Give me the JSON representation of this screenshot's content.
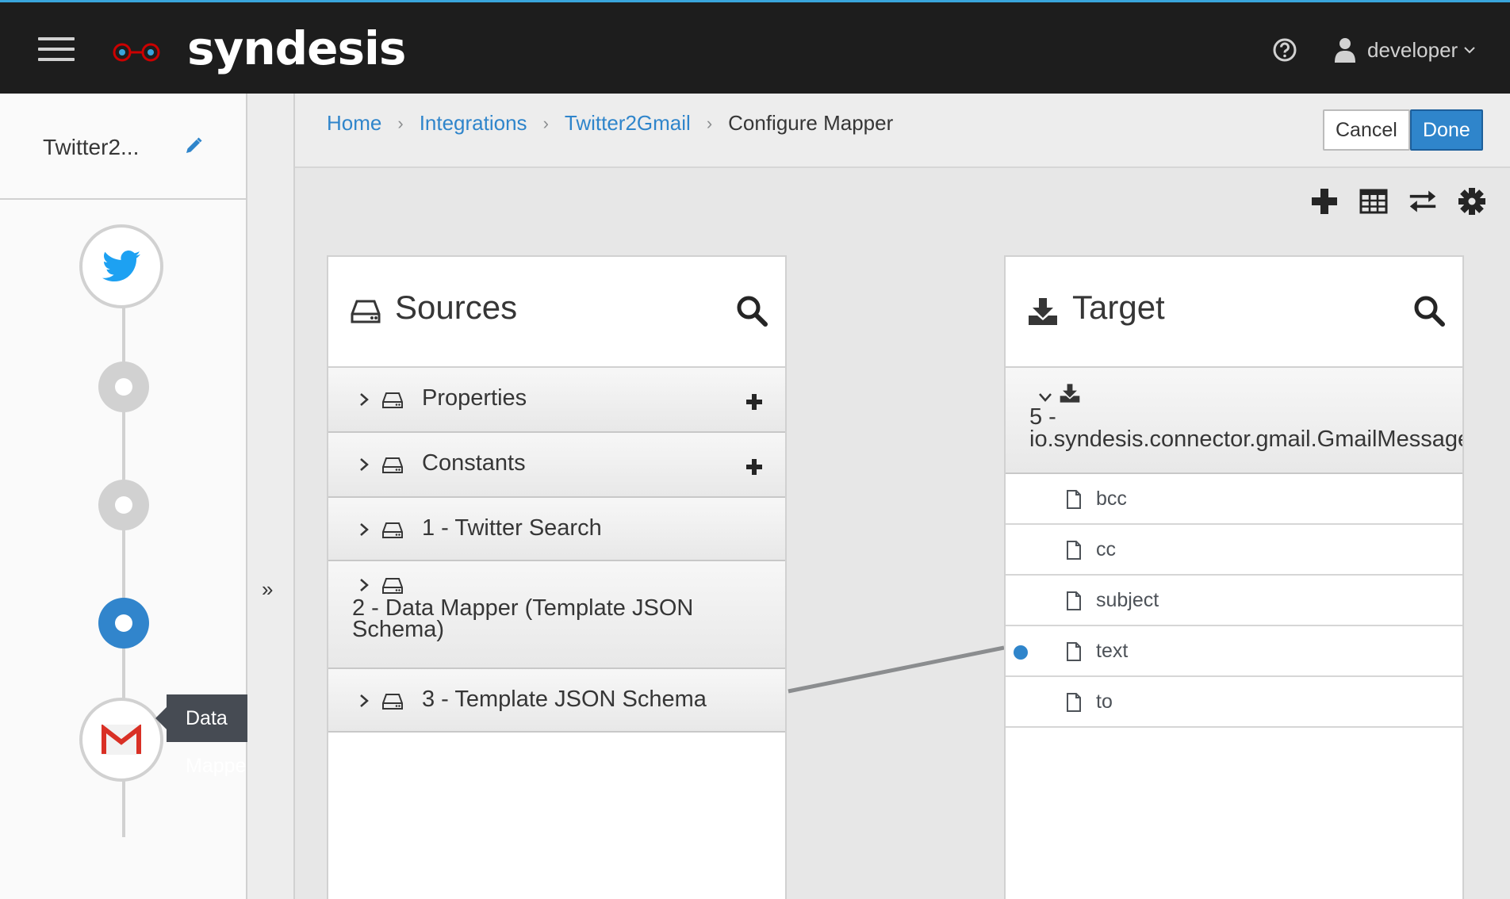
{
  "app": {
    "brand": "syndesis",
    "user": "developer"
  },
  "sidebar": {
    "integration_name": "Twitter2...",
    "tooltip": "Data Mapper",
    "expand_toggle": "»"
  },
  "breadcrumb": [
    {
      "label": "Home"
    },
    {
      "label": "Integrations"
    },
    {
      "label": "Twitter2Gmail"
    },
    {
      "label": "Configure Mapper"
    }
  ],
  "buttons": {
    "cancel": "Cancel",
    "done": "Done"
  },
  "sources": {
    "title": "Sources",
    "documents": [
      {
        "label": "Properties",
        "addable": true
      },
      {
        "label": "Constants",
        "addable": true
      },
      {
        "label": "1 - Twitter Search",
        "addable": false
      },
      {
        "label": "2 - Data Mapper (Template JSON Schema)",
        "addable": false
      },
      {
        "label": "3 - Template JSON Schema",
        "addable": false
      }
    ]
  },
  "target": {
    "title": "Target",
    "document": {
      "label_prefix": "5 -",
      "label": "io.syndesis.connector.gmail.GmailMessage"
    },
    "fields": [
      {
        "label": "bcc",
        "mapped": false
      },
      {
        "label": "cc",
        "mapped": false
      },
      {
        "label": "subject",
        "mapped": false
      },
      {
        "label": "text",
        "mapped": true
      },
      {
        "label": "to",
        "mapped": false
      }
    ]
  },
  "colors": {
    "accent": "#2f85cb",
    "topbar": "#1d1d1d",
    "brand_mark": "#cc0000",
    "twitter": "#1da1f2",
    "gmail": "#d93025"
  }
}
